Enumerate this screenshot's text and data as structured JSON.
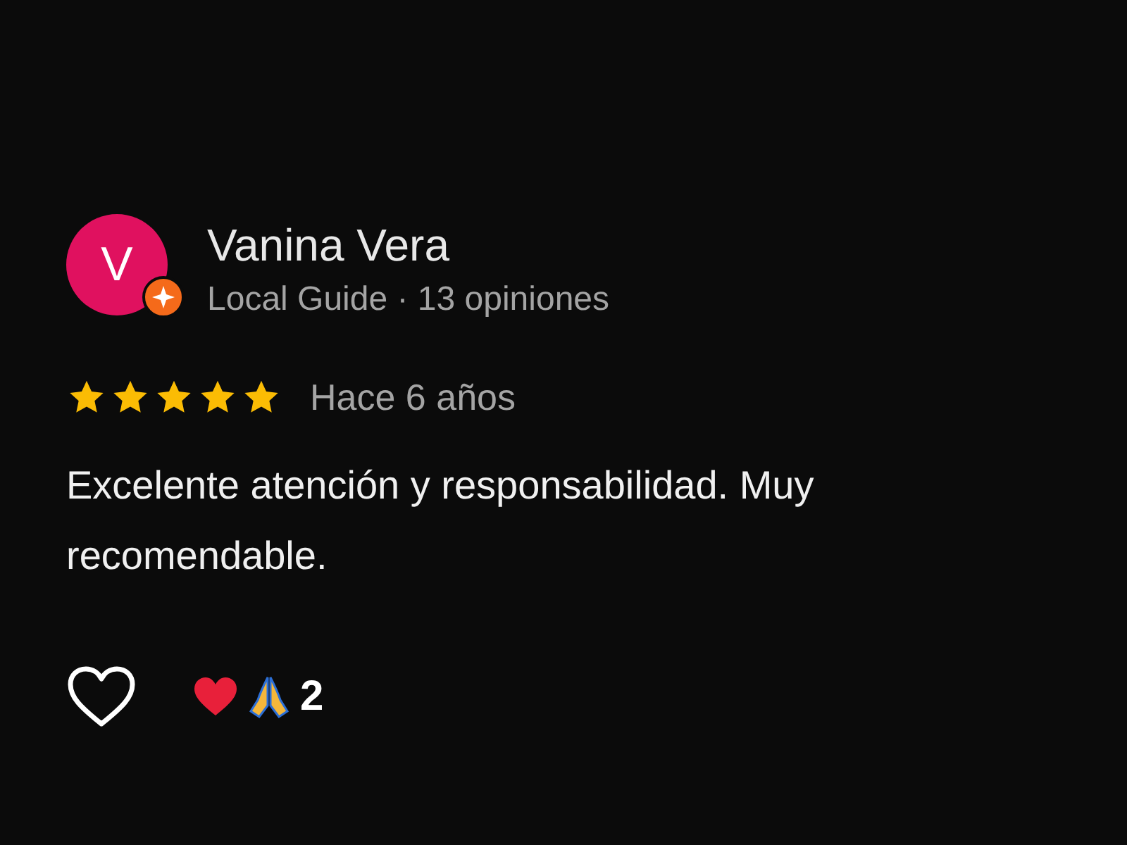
{
  "review": {
    "avatar_letter": "V",
    "author": "Vanina Vera",
    "meta": "Local Guide · 13 opiniones",
    "stars": 5,
    "time": "Hace 6 años",
    "text": "Excelente atención y responsabilidad. Muy recomendable.",
    "reaction_count": "2"
  }
}
